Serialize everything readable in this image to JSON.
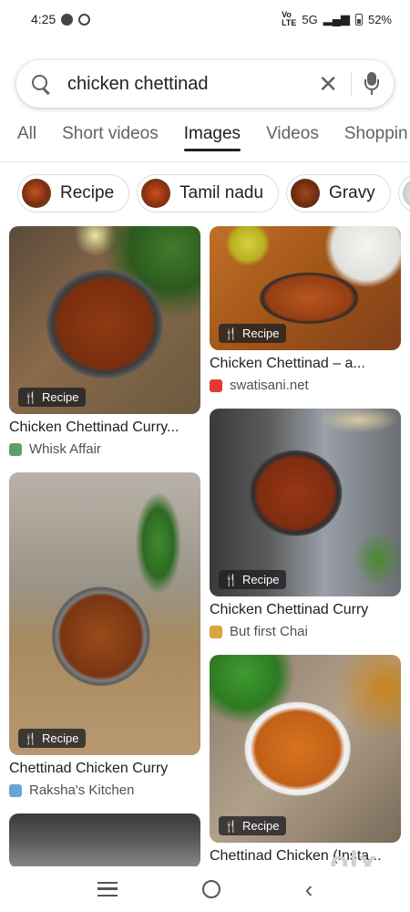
{
  "status_bar": {
    "time": "4:25",
    "network": "5G",
    "lte": "VoLTE",
    "battery": "52%"
  },
  "search": {
    "query": "chicken chettinad",
    "clear_icon": "close-icon",
    "mic_icon": "mic-icon"
  },
  "tabs": [
    {
      "label": "All",
      "active": false
    },
    {
      "label": "Short videos",
      "active": false
    },
    {
      "label": "Images",
      "active": true
    },
    {
      "label": "Videos",
      "active": false
    },
    {
      "label": "Shoppin",
      "active": false
    }
  ],
  "chips": [
    {
      "label": "Recipe",
      "color": "#8b3a1c"
    },
    {
      "label": "Tamil nadu",
      "color": "#a0401c"
    },
    {
      "label": "Gravy",
      "color": "#7a3a16"
    },
    {
      "label": "",
      "color": "#c8c8c8"
    }
  ],
  "results": {
    "left": [
      {
        "title": "Chicken Chettinad Curry...",
        "source": "Whisk Affair",
        "badge": "Recipe",
        "fav_color": "#5fa06a"
      },
      {
        "title": "Chettinad Chicken Curry",
        "source": "Raksha's Kitchen",
        "badge": "Recipe",
        "fav_color": "#6aa3d6"
      },
      {
        "title": "",
        "source": "",
        "badge": "",
        "fav_color": "#333"
      }
    ],
    "right": [
      {
        "title": "Chicken Chettinad – a...",
        "source": "swatisani.net",
        "badge": "Recipe",
        "fav_color": "#e53935"
      },
      {
        "title": "Chicken Chettinad Curry",
        "source": "But first Chai",
        "badge": "Recipe",
        "fav_color": "#d9a441"
      },
      {
        "title": "Chettinad Chicken (Insta...",
        "source": "",
        "badge": "Recipe",
        "fav_color": "#999"
      }
    ]
  },
  "watermark": "olx",
  "colors": {
    "accent": "#202124",
    "curry": "#9a3b12",
    "muted": "#5f6368"
  }
}
